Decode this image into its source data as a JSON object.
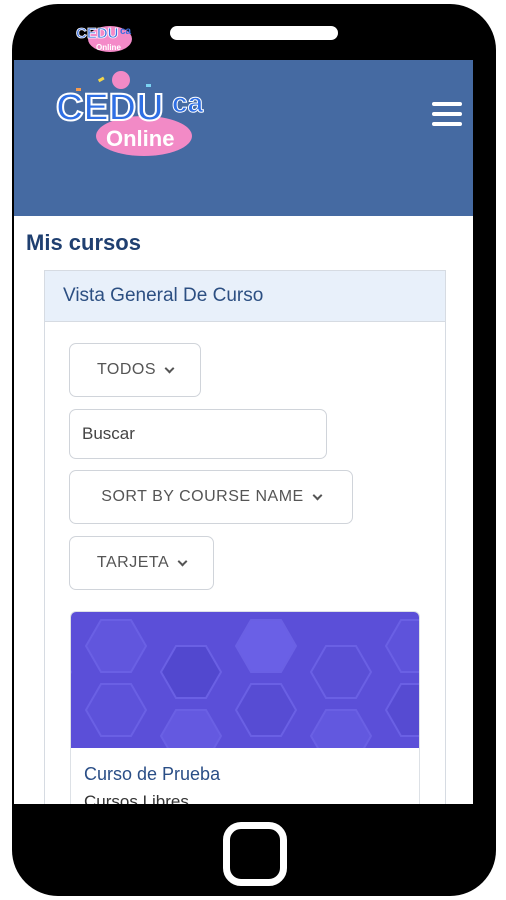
{
  "app": {
    "brand_top": "CEDU",
    "brand_suffix": "ca",
    "brand_sub": "Online"
  },
  "header": {
    "menu_icon": "hamburger-menu-icon",
    "color": "#456aa2"
  },
  "page": {
    "title": "Mis cursos"
  },
  "course_overview": {
    "header": "Vista General De Curso",
    "filter_label": "TODOS",
    "search_placeholder": "Buscar",
    "sort_label": "SORT BY COURSE NAME",
    "view_label": "TARJETA"
  },
  "courses": [
    {
      "name": "Curso de Prueba",
      "category": "Cursos Libres"
    }
  ],
  "colors": {
    "accent": "#2c4f82",
    "course_image": "#5b4fd8"
  }
}
